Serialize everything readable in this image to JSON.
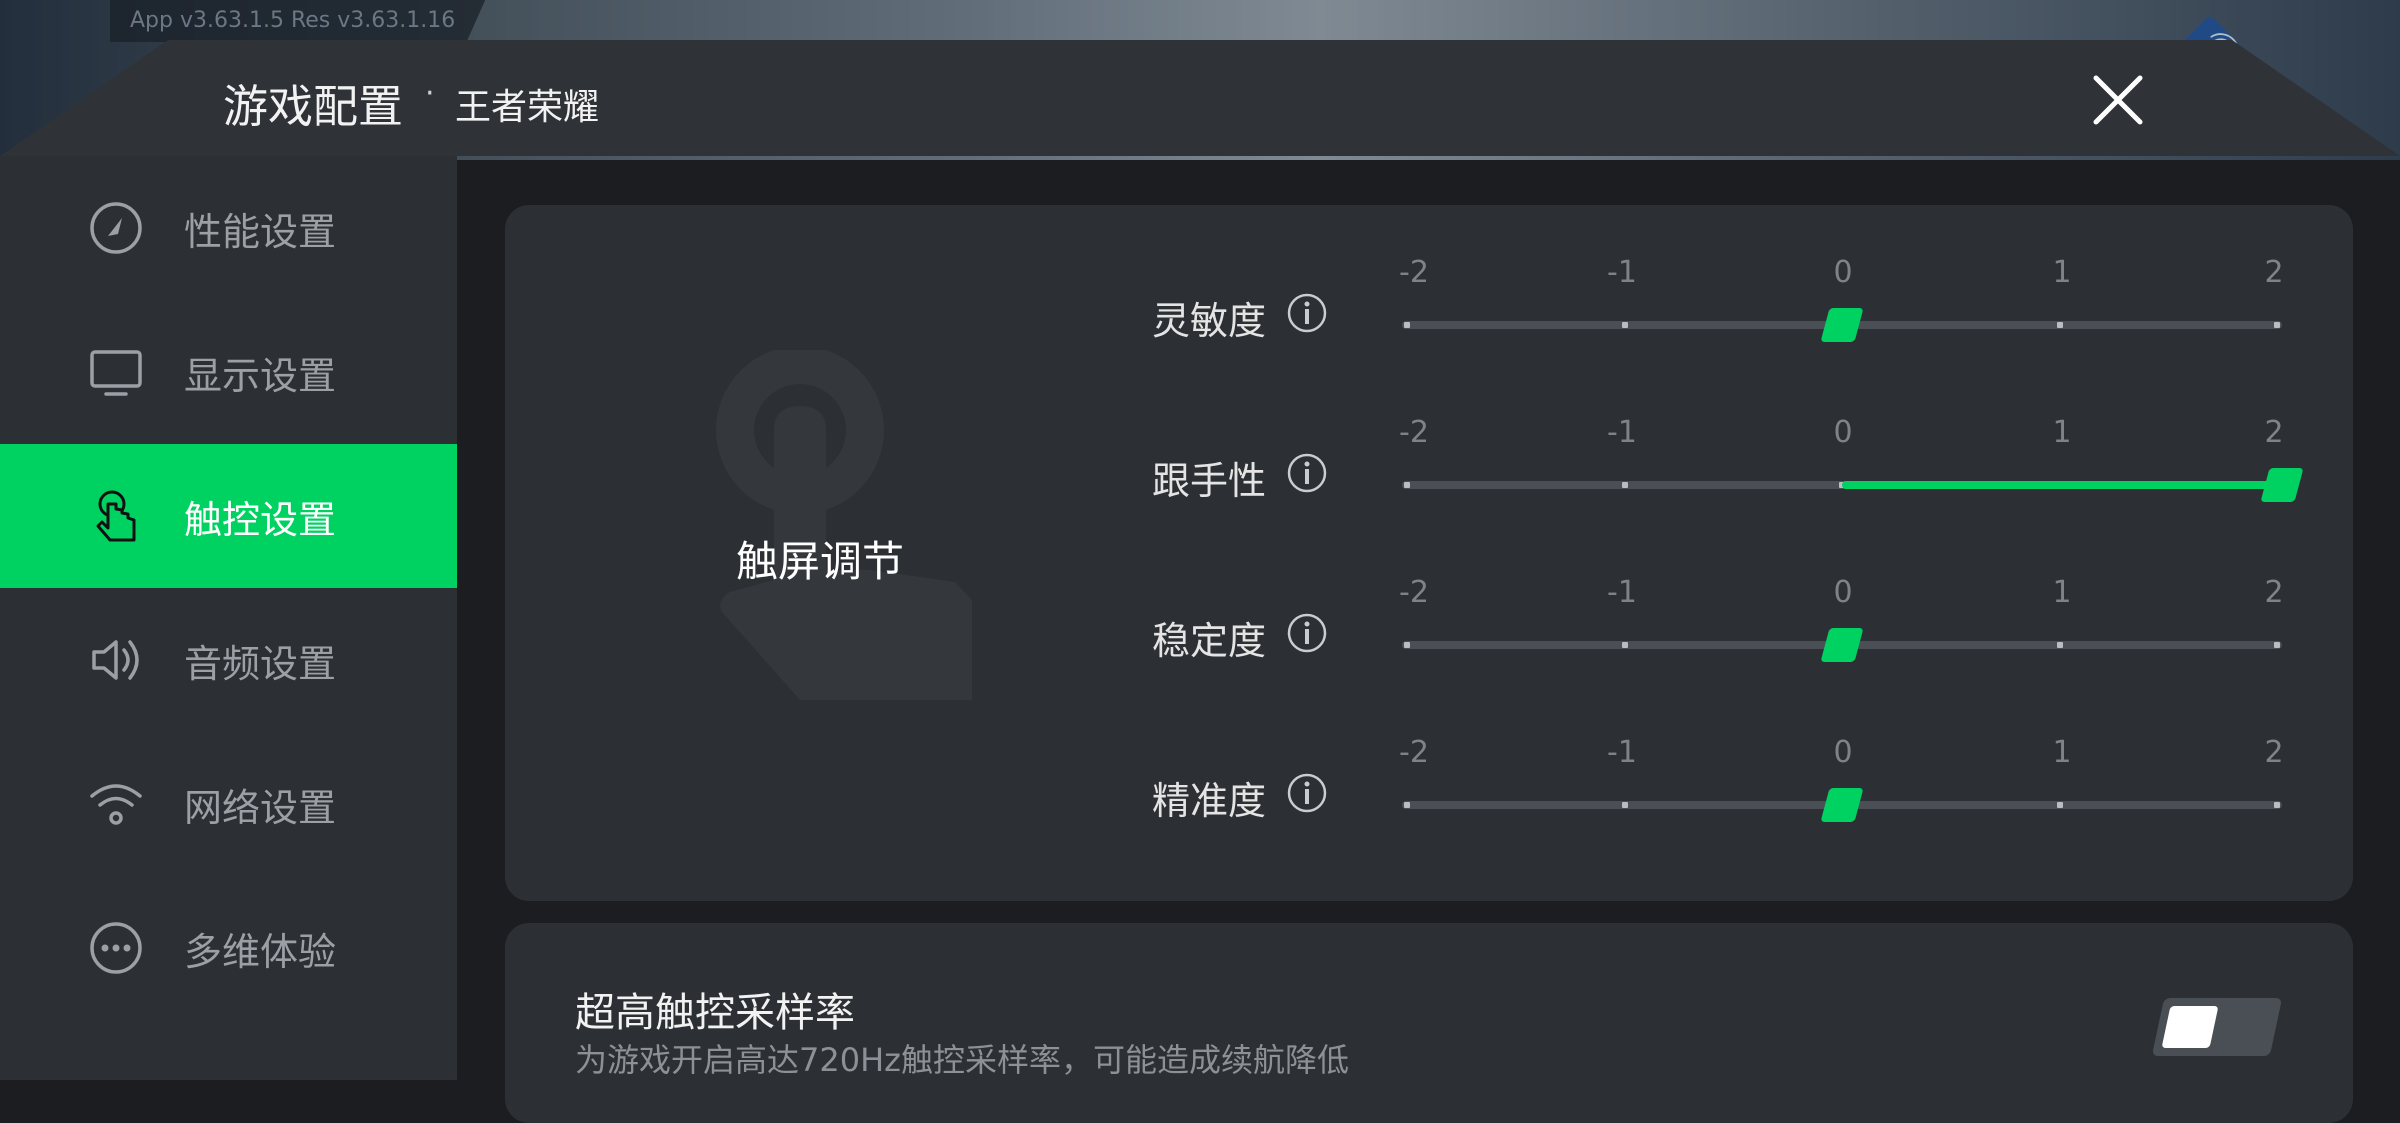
{
  "app": {
    "version": "App v3.63.1.5   Res v3.63.1.16",
    "title": "游戏配置",
    "separator": "·",
    "game": "王者荣耀"
  },
  "colors": {
    "accent": "#00d262",
    "panel": "#2c2f33",
    "background": "#1b1d20"
  },
  "sidebar": {
    "items": [
      {
        "label": "性能设置",
        "icon": "speedometer-icon",
        "active": false
      },
      {
        "label": "显示设置",
        "icon": "monitor-icon",
        "active": false
      },
      {
        "label": "触控设置",
        "icon": "touch-hand-icon",
        "active": true
      },
      {
        "label": "音频设置",
        "icon": "speaker-icon",
        "active": false
      },
      {
        "label": "网络设置",
        "icon": "wifi-icon",
        "active": false
      },
      {
        "label": "多维体验",
        "icon": "more-dots-icon",
        "active": false
      }
    ]
  },
  "touch": {
    "title": "触屏调节",
    "scale": [
      "-2",
      "-1",
      "0",
      "1",
      "2"
    ],
    "sliders": [
      {
        "label": "灵敏度",
        "value": 0
      },
      {
        "label": "跟手性",
        "value": 2
      },
      {
        "label": "稳定度",
        "value": 0
      },
      {
        "label": "精准度",
        "value": 0
      }
    ]
  },
  "sampling": {
    "title": "超高触控采样率",
    "desc": "为游戏开启高达720Hz触控采样率，可能造成续航降低",
    "enabled": false
  }
}
